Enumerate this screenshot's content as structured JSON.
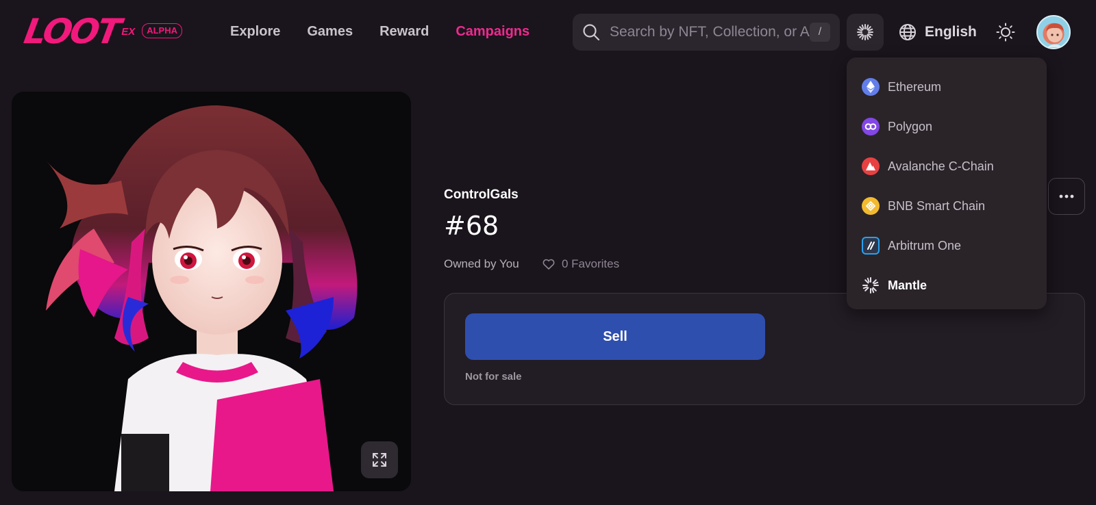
{
  "header": {
    "logo": {
      "text": "LOOT",
      "ex": "EX",
      "badge": "ALPHA",
      "color": "#f2197c"
    },
    "nav": [
      {
        "label": "Explore",
        "active": false
      },
      {
        "label": "Games",
        "active": false
      },
      {
        "label": "Reward",
        "active": false
      },
      {
        "label": "Campaigns",
        "active": true
      }
    ],
    "search": {
      "placeholder": "Search by NFT, Collection, or Account",
      "shortcut": "/"
    },
    "chain_button": {
      "icon": "mantle-icon"
    },
    "language": {
      "label": "English",
      "icon": "globe-icon"
    },
    "theme_toggle": {
      "icon": "sun-icon"
    },
    "avatar": {
      "icon": "user-avatar"
    }
  },
  "chain_dropdown": {
    "items": [
      {
        "label": "Ethereum",
        "icon": "ethereum-icon",
        "color": "#627eea",
        "selected": false
      },
      {
        "label": "Polygon",
        "icon": "polygon-icon",
        "color": "#8247e5",
        "selected": false
      },
      {
        "label": "Avalanche C-Chain",
        "icon": "avalanche-icon",
        "color": "#e84142",
        "selected": false
      },
      {
        "label": "BNB Smart Chain",
        "icon": "bnb-icon",
        "color": "#f3ba2f",
        "selected": false
      },
      {
        "label": "Arbitrum One",
        "icon": "arbitrum-icon",
        "color": "#2d374b",
        "selected": false
      },
      {
        "label": "Mantle",
        "icon": "mantle-icon",
        "color": "#ffffff",
        "selected": true
      }
    ]
  },
  "nft": {
    "image": "anime-girl-artwork",
    "collection": "ControlGals",
    "token_id": "#68",
    "owner_text": "Owned by You",
    "favorites_text": "0 Favorites",
    "sell_label": "Sell",
    "sale_status": "Not for sale"
  },
  "colors": {
    "background": "#1a141c",
    "accent": "#ee2a8f",
    "sell_button": "#2f4fae"
  }
}
